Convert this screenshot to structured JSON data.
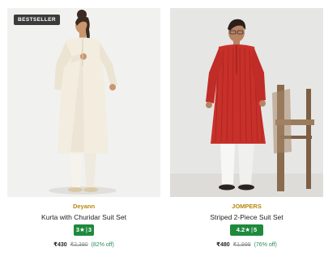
{
  "products": [
    {
      "badge": "BESTSELLER",
      "brand": "Deyann",
      "name": "Kurta with Churidar Suit Set",
      "rating": "3",
      "rating_star": "★",
      "rating_sep": "|",
      "rating_count": "3",
      "price": "₹430",
      "mrp": "₹2,390",
      "discount": "(82% off)"
    },
    {
      "brand": "JOMPERS",
      "name": "Striped 2-Piece Suit Set",
      "rating": "4.2",
      "rating_star": "★",
      "rating_sep": "|",
      "rating_count": "5",
      "price": "₹480",
      "mrp": "₹1,999",
      "discount": "(76% off)"
    }
  ],
  "colors": {
    "brand_text": "#b8860b",
    "rating_bg": "#1e8a3c",
    "discount_text": "#2e8b57",
    "badge_bg": "#3b3b3b",
    "kurta_cream": "#f3ede0",
    "kurta_red": "#c8302a"
  }
}
